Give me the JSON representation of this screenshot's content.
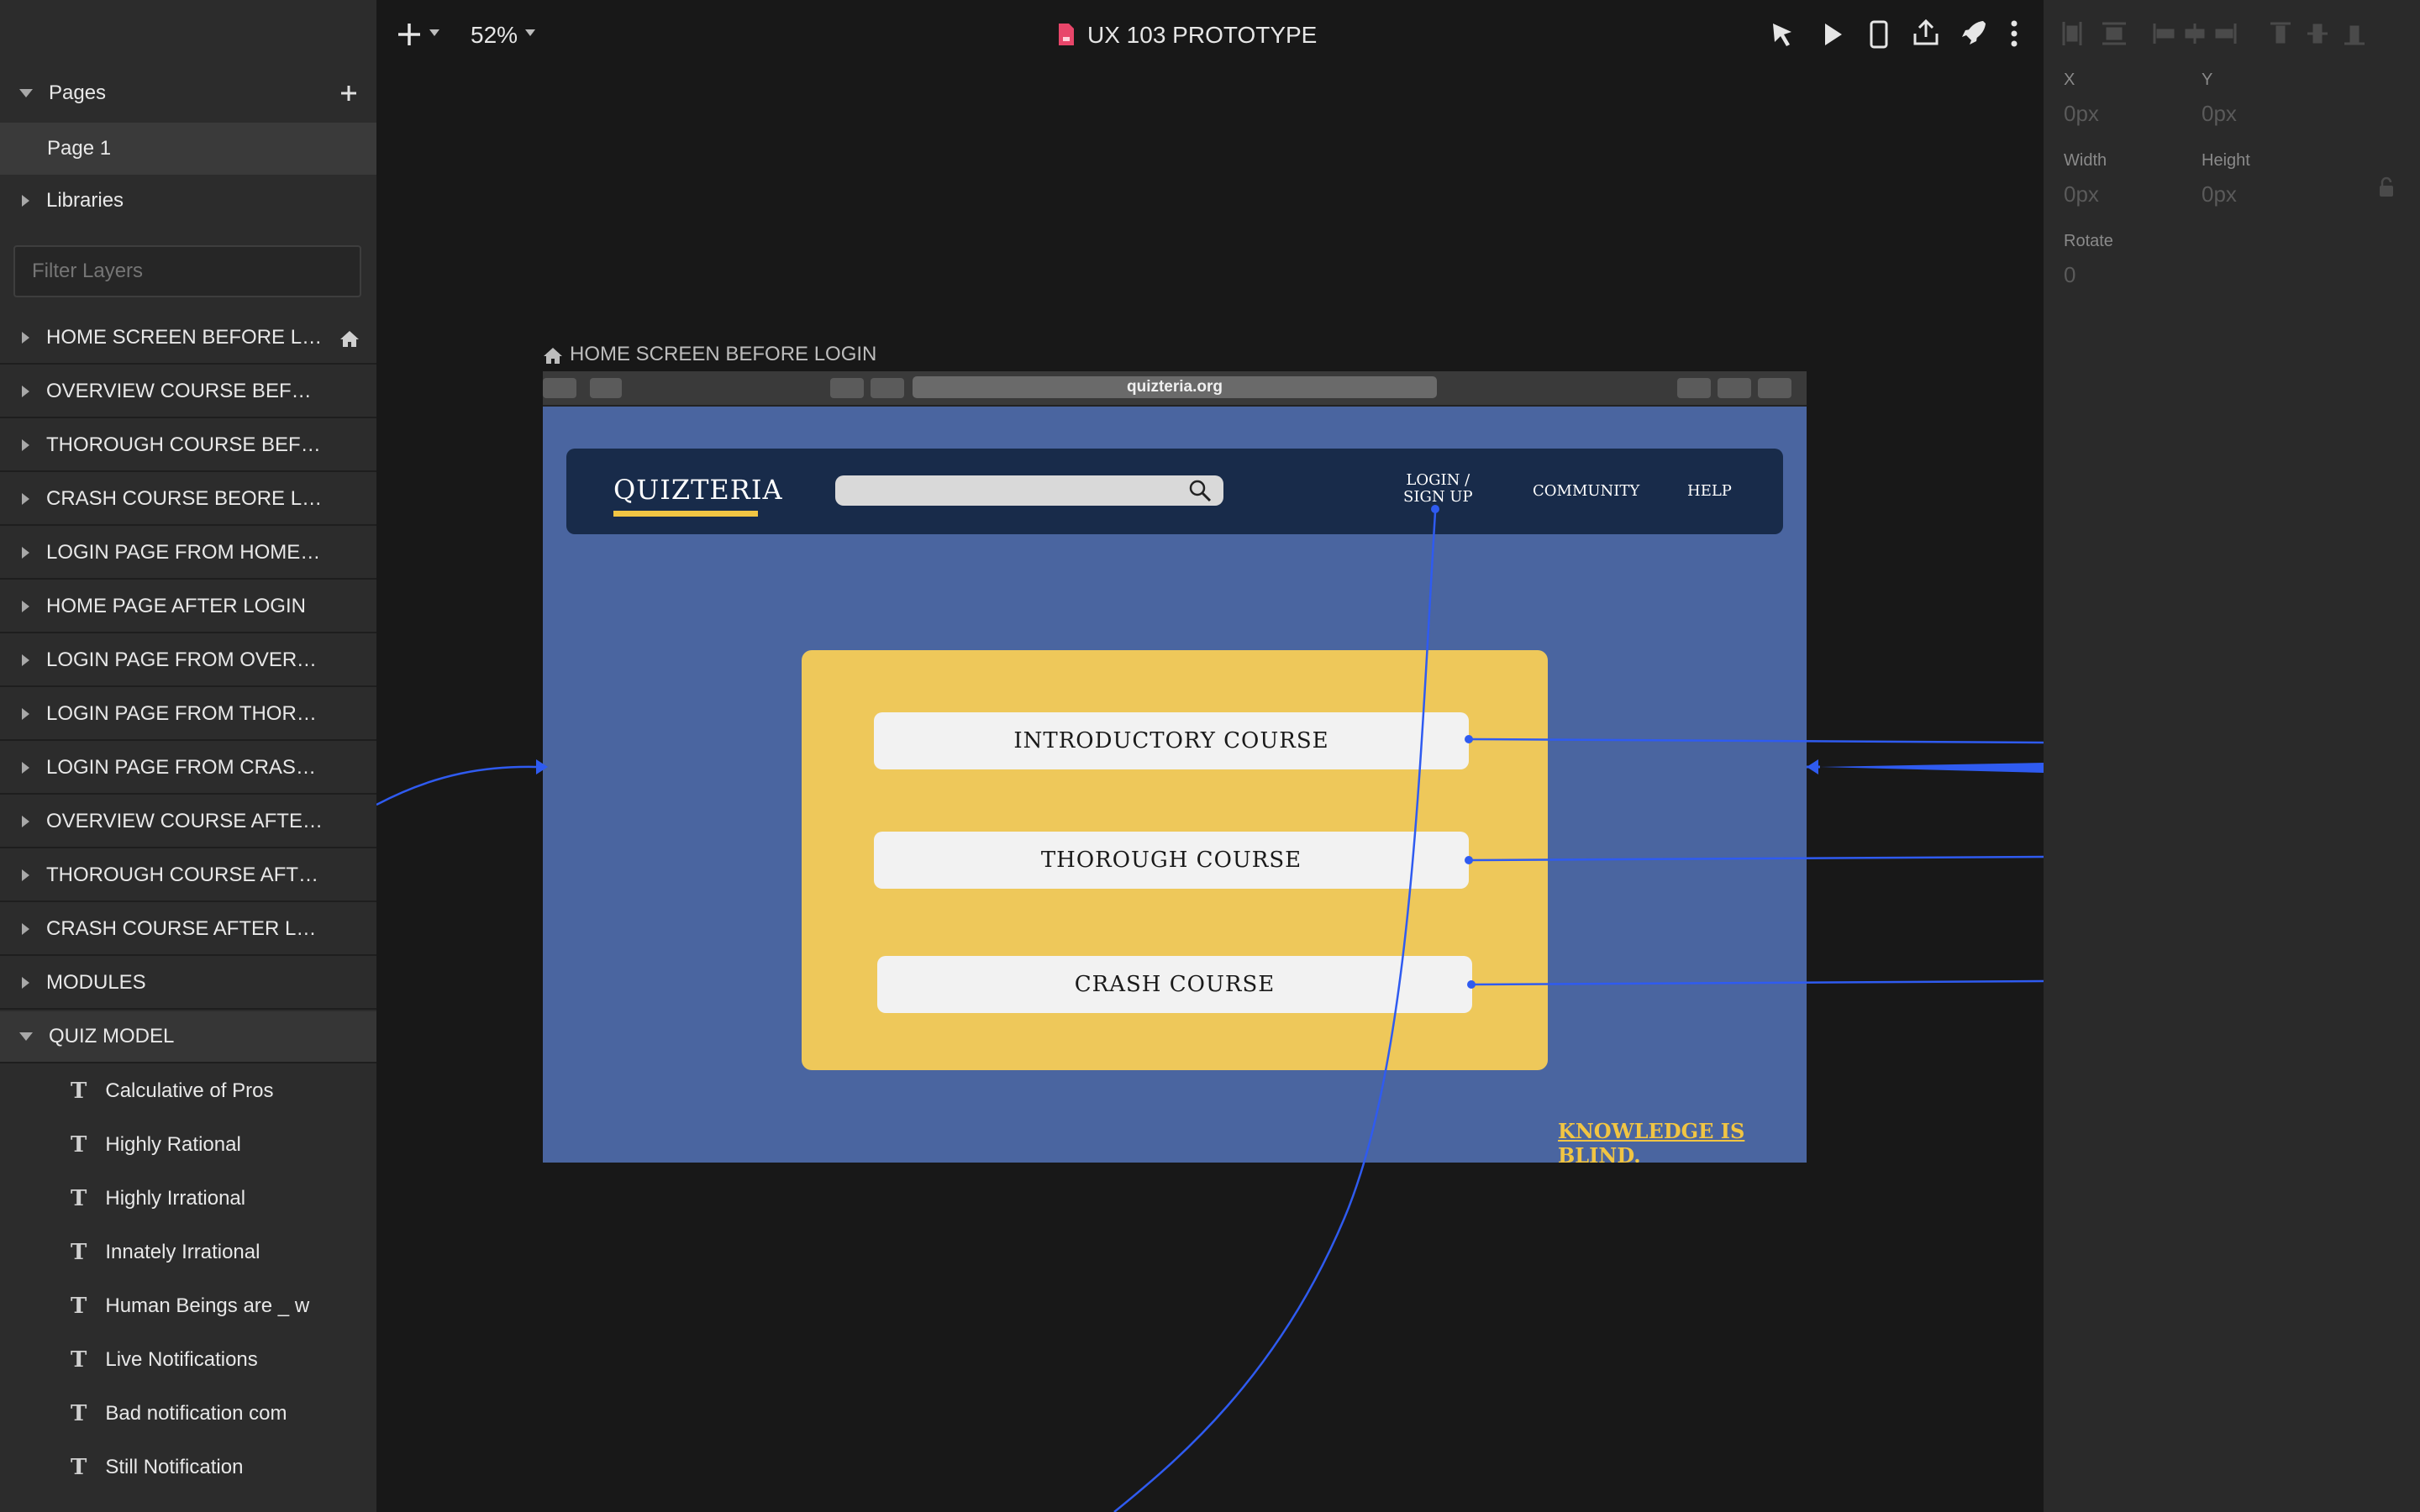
{
  "sidebar": {
    "pages_label": "Pages",
    "add_icon": "plus-icon",
    "current_page": "Page 1",
    "libraries_label": "Libraries",
    "filter_placeholder": "Filter Layers",
    "layers": [
      {
        "label": "HOME SCREEN BEFORE LOGIN",
        "display": "HOME SCREEN BEFORE LO...",
        "home": true
      },
      {
        "label": "OVERVIEW COURSE BEFORE LOGIN",
        "display": "OVERVIEW COURSE BEFORE L..."
      },
      {
        "label": "THOROUGH COURSE BEFORE LOGIN",
        "display": "THOROUGH COURSE BEFORE ..."
      },
      {
        "label": "CRASH COURSE BEORE LOGIN",
        "display": "CRASH COURSE BEORE LOGIN"
      },
      {
        "label": "LOGIN PAGE FROM HOME PAGE",
        "display": "LOGIN PAGE FROM HOME PAGE"
      },
      {
        "label": "HOME PAGE AFTER LOGIN",
        "display": "HOME PAGE AFTER LOGIN"
      },
      {
        "label": "LOGIN PAGE FROM OVERVIEW",
        "display": "LOGIN PAGE FROM OVERVIEW ..."
      },
      {
        "label": "LOGIN PAGE FROM THOROUGH",
        "display": "LOGIN PAGE FROM THOROUG..."
      },
      {
        "label": "LOGIN PAGE FROM CRASH COURSE",
        "display": "LOGIN PAGE FROM CRASH CO..."
      },
      {
        "label": "OVERVIEW COURSE AFTER LOGIN",
        "display": "OVERVIEW COURSE AFTER LO..."
      },
      {
        "label": "THOROUGH COURSE AFTER LOGIN",
        "display": "THOROUGH COURSE AFTER L..."
      },
      {
        "label": "CRASH COURSE AFTER LOGIN",
        "display": "CRASH COURSE AFTER LOGIN"
      },
      {
        "label": "MODULES",
        "display": "MODULES"
      },
      {
        "label": "QUIZ MODEL",
        "display": "QUIZ MODEL",
        "expanded": true
      }
    ],
    "quiz_children": [
      "Calculative of Pros",
      "Highly Rational",
      "Highly Irrational",
      "Innately Irrational",
      "Human Beings are _ w",
      "Live Notifications",
      "Bad notification com",
      "Still Notification"
    ]
  },
  "toolbar": {
    "add_icon": "plus-icon",
    "zoom": "52%",
    "doc_title": "UX 103 PROTOTYPE",
    "doc_icon_color": "#e8466a",
    "icons": [
      "cursor-icon",
      "play-icon",
      "device-icon",
      "upload-icon",
      "rocket-icon",
      "more-vertical-icon"
    ]
  },
  "inspector": {
    "x_label": "X",
    "x_value": "0px",
    "y_label": "Y",
    "y_value": "0px",
    "width_label": "Width",
    "width_value": "0px",
    "height_label": "Height",
    "height_value": "0px",
    "rotate_label": "Rotate",
    "rotate_value": "0"
  },
  "artboard": {
    "title": "HOME SCREEN BEFORE LOGIN",
    "url": "quizteria.org",
    "logo": "QUIZTERIA",
    "nav": {
      "login_line1": "LOGIN /",
      "login_line2": "SIGN UP",
      "community": "COMMUNITY",
      "help": "HELP"
    },
    "courses": [
      "INTRODUCTORY COURSE",
      "THOROUGH COURSE",
      "CRASH COURSE"
    ],
    "tagline": "KNOWLEDGE IS BLIND.",
    "colors": {
      "background": "#4a65a0",
      "navbar": "#182b4a",
      "card": "#eec85a",
      "accent": "#f1c543",
      "link": "#2f5bf0"
    }
  }
}
